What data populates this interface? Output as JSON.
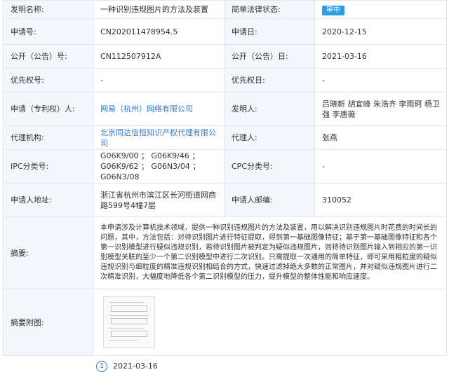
{
  "fields": {
    "name_label": "发明名称:",
    "name_value": "一种识别违规图片的方法及装置",
    "status_label": "简单法律状态:",
    "status_value": "审中",
    "appno_label": "申请号:",
    "appno_value": "CN202011478954.5",
    "appdate_label": "申请日:",
    "appdate_value": "2020-12-15",
    "pubno_label": "公开（公告）号:",
    "pubno_value": "CN112507912A",
    "pubdate_label": "公开（公告）日:",
    "pubdate_value": "2021-03-16",
    "priority_label": "优先权号:",
    "priority_value": "-",
    "prioritydate_label": "优先权日:",
    "prioritydate_value": "-",
    "applicant_label": "申请（专利权）人:",
    "applicant_value": "网易（杭州）网络有限公司",
    "inventor_label": "发明人:",
    "inventor_value": "吕晓新 胡宜峰 朱浩齐 李雨珂 杨卫强 李唐薇",
    "agency_label": "代理机构:",
    "agency_value": "北京同达信恒知识产权代理有限公司",
    "agent_label": "代理人:",
    "agent_value": "张燕",
    "ipc_label": "IPC分类号:",
    "ipc_value": "G06K9/00 ； G06K9/46 ； G06K9/62 ； G06N3/04 ； G06N3/08",
    "cpc_label": "CPC分类号:",
    "cpc_value": "-",
    "address_label": "申请人地址:",
    "address_value": "浙江省杭州市滨江区长河街道网商路599号4幢7层",
    "postcode_label": "申请人邮编:",
    "postcode_value": "310052",
    "abstract_label": "摘要:",
    "abstract_value": "本申请涉及计算机技术领域，提供一种识别违规图片的方法及装置，用以解决识别违规图片时花费的时间长的问题，其中，方法包括：对待识别图片进行特征提取，得到第一基础图像特征；基于第一基础图像特征和各个第一识别模型进行疑似违规识别，若待识别图片被判定为疑似违规图片，则将待识别图片输入到相应的第一识别模型关联的至少一个第二识别模型中进行二次识别。只需提取一次通用的简单特征，即可采用粗粒度的疑似违规识别与细粒度的精准违规识别相结合的方式，快速过滤掉绝大多数的正常图片，并对疑似违规图片进行二次精准识别，大幅度地降低各个第二识别模型的压力，提升模型的整体性能和响应速度。",
    "figure_label": "摘要附图:"
  },
  "timeline": {
    "number": "1",
    "date": "2021-03-16"
  }
}
